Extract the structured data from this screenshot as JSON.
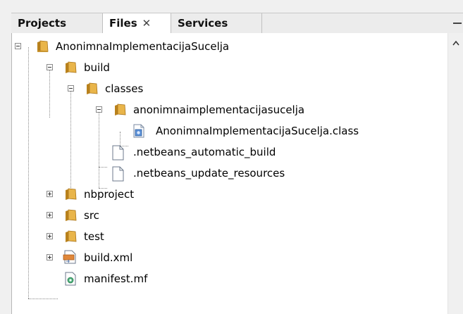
{
  "tabs": [
    {
      "label": "Projects",
      "active": false
    },
    {
      "label": "Files",
      "active": true,
      "close_glyph": "✕"
    },
    {
      "label": "Services",
      "active": false
    }
  ],
  "tree": {
    "items": [
      {
        "label": "AnonimnaImplementacijaSucelja",
        "icon": "project-folder-icon",
        "state": "expanded"
      },
      {
        "label": "build",
        "icon": "folder-icon",
        "state": "expanded"
      },
      {
        "label": "classes",
        "icon": "folder-icon",
        "state": "expanded"
      },
      {
        "label": "anonimnaimplementacijasucelja",
        "icon": "folder-icon",
        "state": "expanded"
      },
      {
        "label": "AnonimnaImplementacijaSucelja.class",
        "icon": "class-file-icon",
        "state": "leaf"
      },
      {
        "label": ".netbeans_automatic_build",
        "icon": "file-icon",
        "state": "leaf"
      },
      {
        "label": ".netbeans_update_resources",
        "icon": "file-icon",
        "state": "leaf"
      },
      {
        "label": "nbproject",
        "icon": "folder-icon",
        "state": "collapsed"
      },
      {
        "label": "src",
        "icon": "folder-icon",
        "state": "collapsed"
      },
      {
        "label": "test",
        "icon": "folder-icon",
        "state": "collapsed"
      },
      {
        "label": "build.xml",
        "icon": "xml-file-icon",
        "state": "collapsed"
      },
      {
        "label": "manifest.mf",
        "icon": "manifest-file-icon",
        "state": "leaf"
      }
    ]
  },
  "colors": {
    "folder": "#e9b54a",
    "folder_dark": "#b9821d",
    "selection_border": "#7da2ce"
  }
}
